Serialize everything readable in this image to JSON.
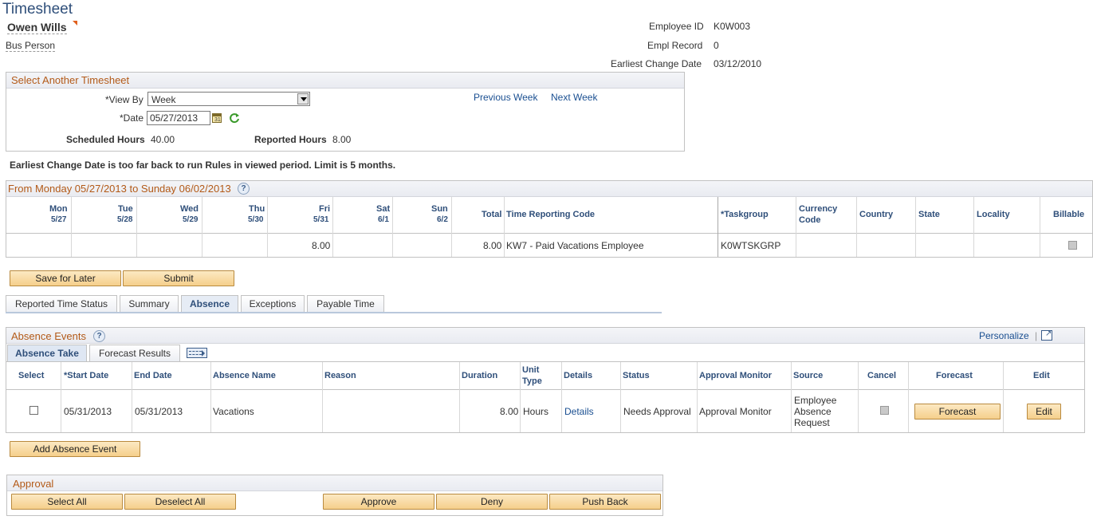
{
  "page": {
    "title": "Timesheet",
    "employee_name": "Owen Wills",
    "role": "Bus Person",
    "employee_id_label": "Employee ID",
    "employee_id": "K0W003",
    "empl_record_label": "Empl Record",
    "empl_record": "0",
    "earliest_change_label": "Earliest Change Date",
    "earliest_change_date": "03/12/2010"
  },
  "select_timesheet": {
    "title": "Select Another Timesheet",
    "view_by_label": "*View By",
    "view_by_value": "Week",
    "date_label": "*Date",
    "date_value": "05/27/2013",
    "previous_week": "Previous Week",
    "next_week": "Next Week",
    "scheduled_hours_label": "Scheduled Hours",
    "scheduled_hours": "40.00",
    "reported_hours_label": "Reported Hours",
    "reported_hours": "8.00"
  },
  "warning": "Earliest Change Date is too far back to run Rules in viewed period. Limit is 5 months.",
  "period": {
    "title": "From Monday 05/27/2013 to Sunday 06/02/2013",
    "days": [
      {
        "day": "Mon",
        "date": "5/27"
      },
      {
        "day": "Tue",
        "date": "5/28"
      },
      {
        "day": "Wed",
        "date": "5/29"
      },
      {
        "day": "Thu",
        "date": "5/30"
      },
      {
        "day": "Fri",
        "date": "5/31"
      },
      {
        "day": "Sat",
        "date": "6/1"
      },
      {
        "day": "Sun",
        "date": "6/2"
      }
    ],
    "columns": {
      "total": "Total",
      "trc": "Time Reporting Code",
      "taskgroup": "*Taskgroup",
      "currency_1": "Currency",
      "currency_2": "Code",
      "country": "Country",
      "state": "State",
      "locality": "Locality",
      "billable": "Billable"
    },
    "row": {
      "fri": "8.00",
      "total": "8.00",
      "trc": "KW7 - Paid Vacations Employee",
      "taskgroup": "K0WTSKGRP"
    }
  },
  "actions": {
    "save_for_later": "Save for Later",
    "submit": "Submit"
  },
  "tabs": [
    "Reported Time Status",
    "Summary",
    "Absence",
    "Exceptions",
    "Payable Time"
  ],
  "absence": {
    "title": "Absence Events",
    "personalize": "Personalize",
    "subtabs": [
      "Absence Take",
      "Forecast Results"
    ],
    "columns": {
      "select": "Select",
      "start_date": "*Start Date",
      "end_date": "End Date",
      "absence_name": "Absence Name",
      "reason": "Reason",
      "duration": "Duration",
      "unit_1": "Unit",
      "unit_2": "Type",
      "details": "Details",
      "status": "Status",
      "approval_monitor": "Approval Monitor",
      "source": "Source",
      "cancel": "Cancel",
      "forecast": "Forecast",
      "edit": "Edit"
    },
    "row": {
      "start_date": "05/31/2013",
      "end_date": "05/31/2013",
      "absence_name": "Vacations",
      "duration": "8.00",
      "unit_type": "Hours",
      "details": "Details",
      "status": "Needs Approval",
      "approval_monitor": "Approval Monitor",
      "source_1": "Employee",
      "source_2": "Absence",
      "source_3": "Request",
      "forecast_button": "Forecast",
      "edit_button": "Edit"
    },
    "add_button": "Add Absence Event"
  },
  "approval": {
    "title": "Approval",
    "select_all": "Select All",
    "deselect_all": "Deselect All",
    "approve": "Approve",
    "deny": "Deny",
    "push_back": "Push Back"
  },
  "colors": {
    "accent": "#2f4f7a",
    "section_title": "#b35a18",
    "button": "#f5cf8b"
  },
  "icons": {
    "calendar": "calendar-icon",
    "refresh": "refresh-icon",
    "help": "help-icon",
    "new_window": "new-window-icon",
    "show_all_columns": "show-all-columns-icon"
  }
}
